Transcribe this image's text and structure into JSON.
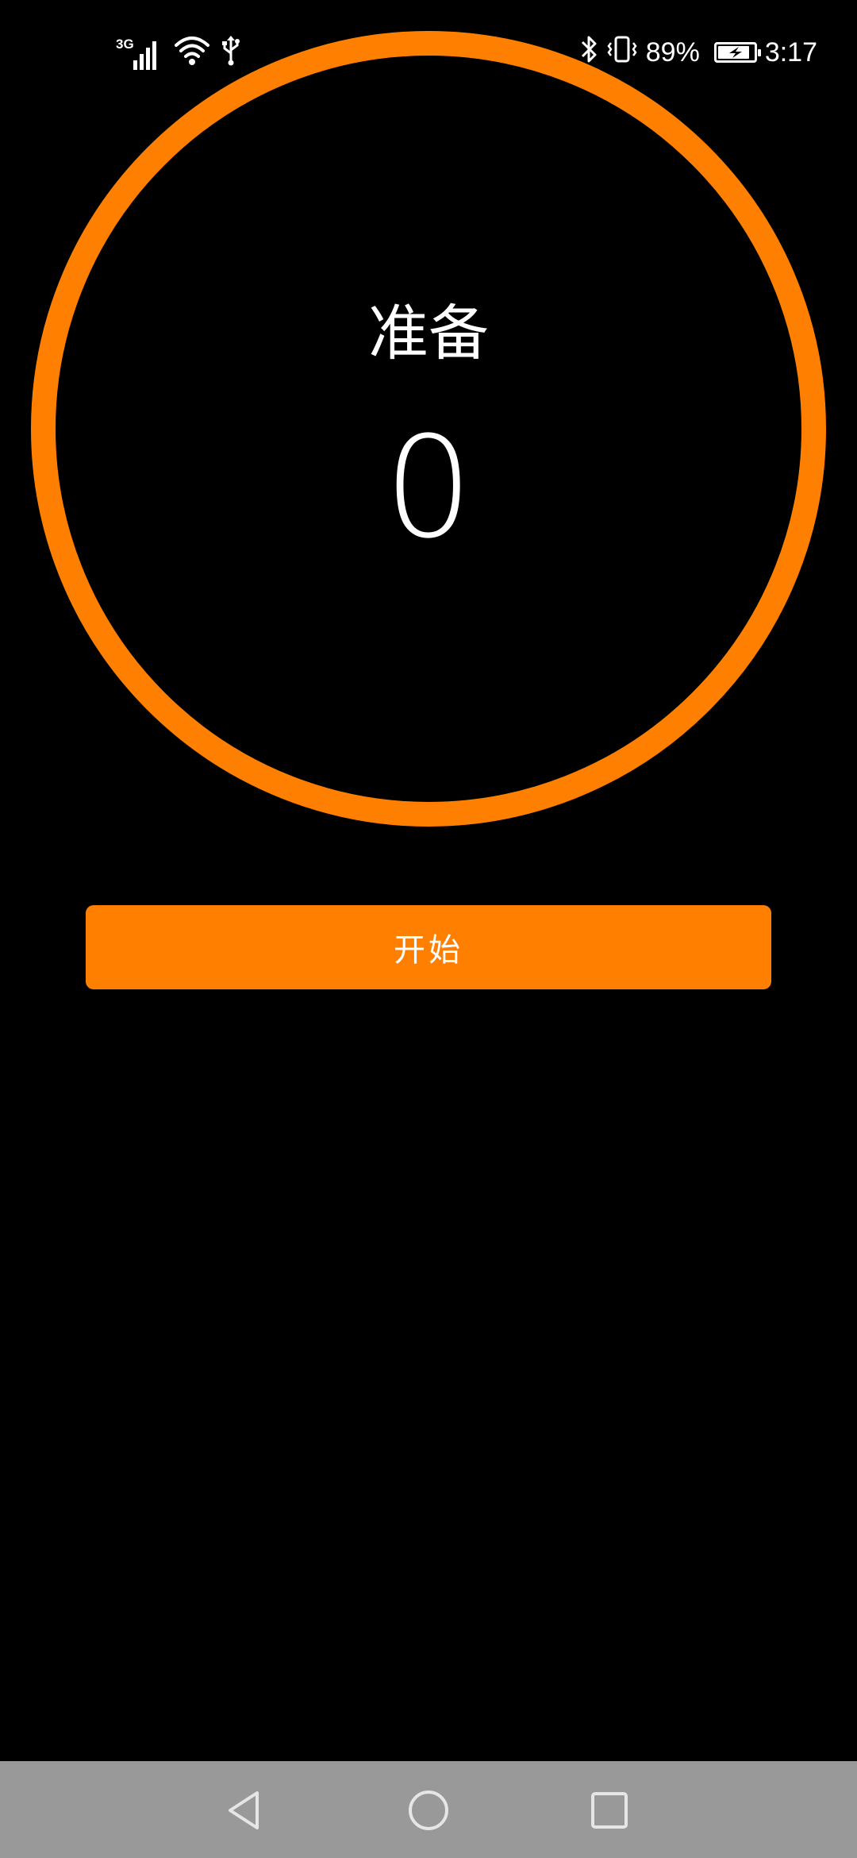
{
  "status_bar": {
    "network_type": "3G",
    "battery_percent": "89%",
    "battery_level": 0.89,
    "time": "3:17",
    "icons": [
      "signal-icon",
      "wifi-icon",
      "usb-icon",
      "bluetooth-icon",
      "vibrate-icon",
      "battery-charging-icon"
    ]
  },
  "timer": {
    "state_label": "准备",
    "count": "0",
    "ring_color": "#ff8000"
  },
  "start_button": {
    "label": "开始",
    "color": "#ff8000"
  },
  "nav_bar": {
    "icons": [
      "back-icon",
      "home-icon",
      "recents-icon"
    ],
    "background": "#999999"
  }
}
